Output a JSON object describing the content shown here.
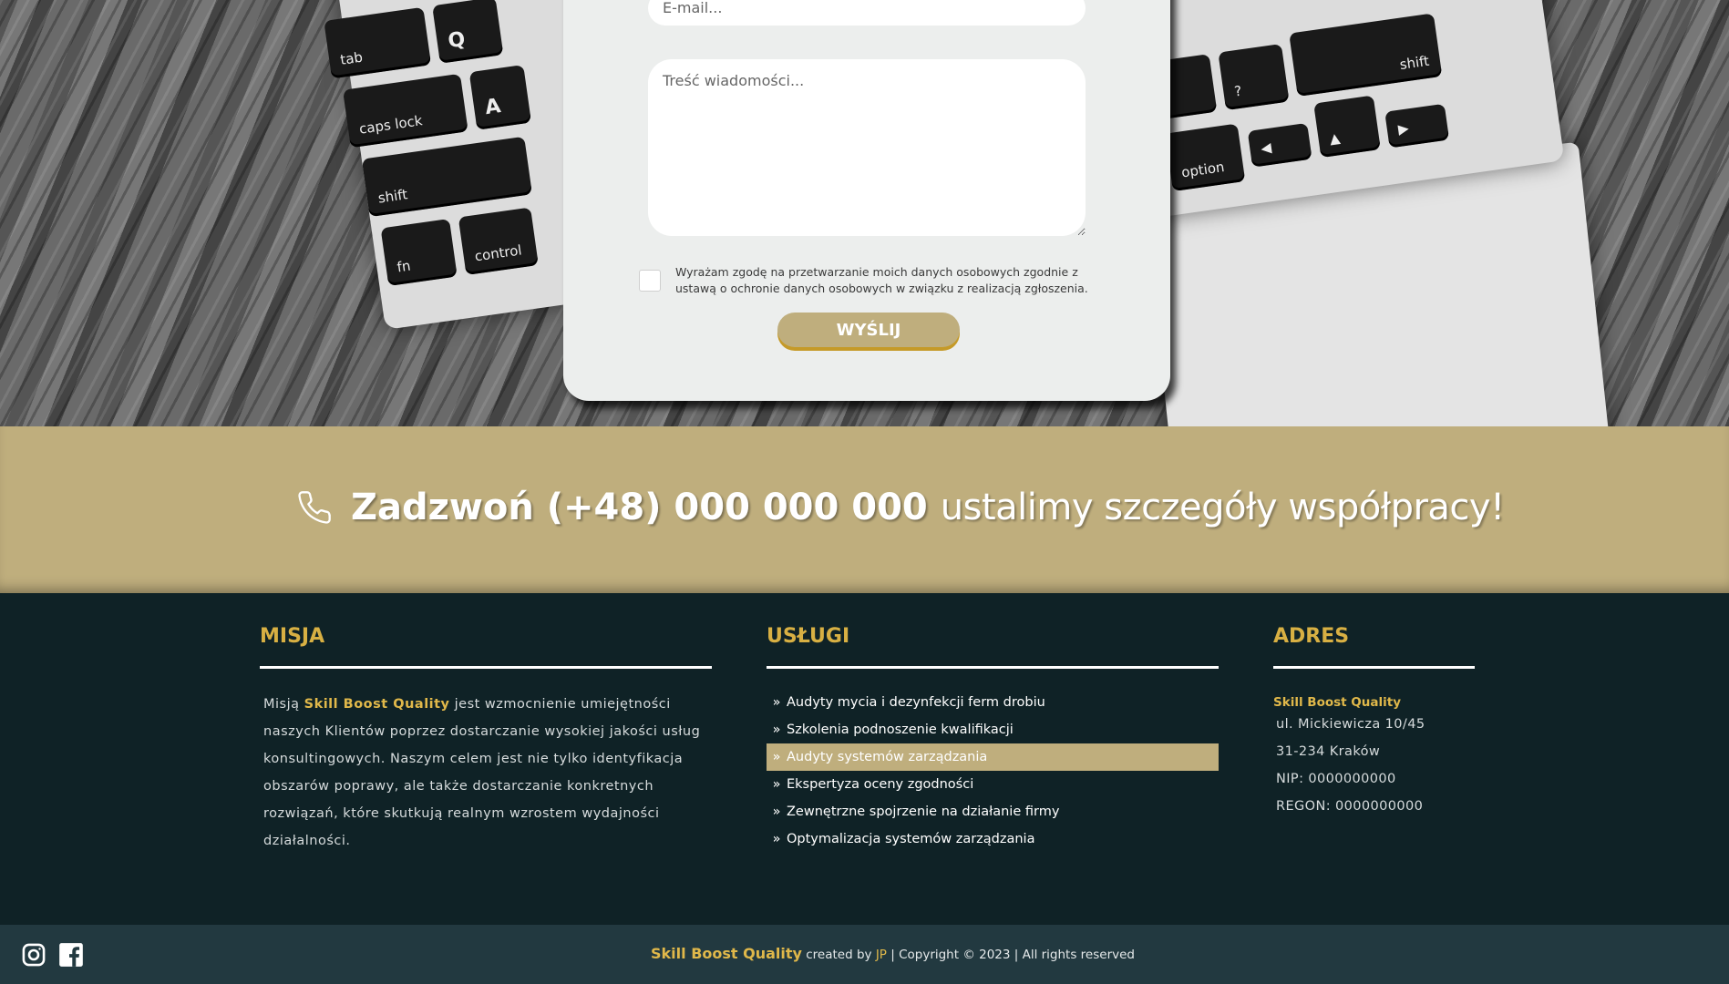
{
  "contact_form": {
    "email_placeholder": "E-mail...",
    "message_placeholder": "Treść wiadomości...",
    "consent_text": "Wyrażam zgodę na przetwarzanie moich danych osobowych zgodnie z ustawą o ochronie danych osobowych w związku z realizacją zgłoszenia.",
    "consent_checked": false,
    "submit_label": "WYŚLIJ"
  },
  "hero_keys": [
    "tab",
    "Q",
    "caps lock",
    "A",
    "shift",
    "fn",
    "control",
    "shift",
    "option"
  ],
  "call_band": {
    "strong_text": "Zadzwoń (+48) 000 000 000",
    "light_text": "ustalimy szczegóły współpracy!",
    "icon": "phone-icon"
  },
  "footer": {
    "misja": {
      "heading": "MISJA",
      "text_before": "Misją ",
      "brand": "Skill Boost Quality",
      "text_after": " jest wzmocnienie umiejętności naszych Klientów poprzez dostarczanie wysokiej jakości usług konsultingowych. Naszym celem jest nie tylko identyfikacja obszarów poprawy, ale także dostarczanie konkretnych rozwiązań, które skutkują realnym wzrostem wydajności działalności."
    },
    "uslugi": {
      "heading": "USŁUGI",
      "marker": "»",
      "items": [
        {
          "label": "Audyty mycia i dezynfekcji ferm drobiu",
          "active": false
        },
        {
          "label": "Szkolenia podnoszenie kwalifikacji",
          "active": false
        },
        {
          "label": "Audyty systemów zarządzania",
          "active": true
        },
        {
          "label": "Ekspertyza oceny zgodności",
          "active": false
        },
        {
          "label": "Zewnętrzne spojrzenie na działanie firmy",
          "active": false
        },
        {
          "label": "Optymalizacja systemów zarządzania",
          "active": false
        }
      ]
    },
    "adres": {
      "heading": "ADRES",
      "brand": "Skill Boost Quality",
      "street": "ul. Mickiewicza 10/45",
      "city": "31-234 Kraków",
      "nip": "NIP: 0000000000",
      "regon": "REGON: 0000000000"
    }
  },
  "bottom_bar": {
    "brand": "Skill Boost Quality",
    "created_by": " created by ",
    "author": "JP",
    "copyright": " | Copyright © 2023 | All rights reserved",
    "social_icons": [
      "instagram-icon",
      "facebook-icon"
    ]
  },
  "colors": {
    "gold": "#bfae7d",
    "gold_text": "#d8b043",
    "footer_bg": "#0f2226",
    "bottom_bg": "#223940",
    "card_bg": "#eceeed"
  }
}
